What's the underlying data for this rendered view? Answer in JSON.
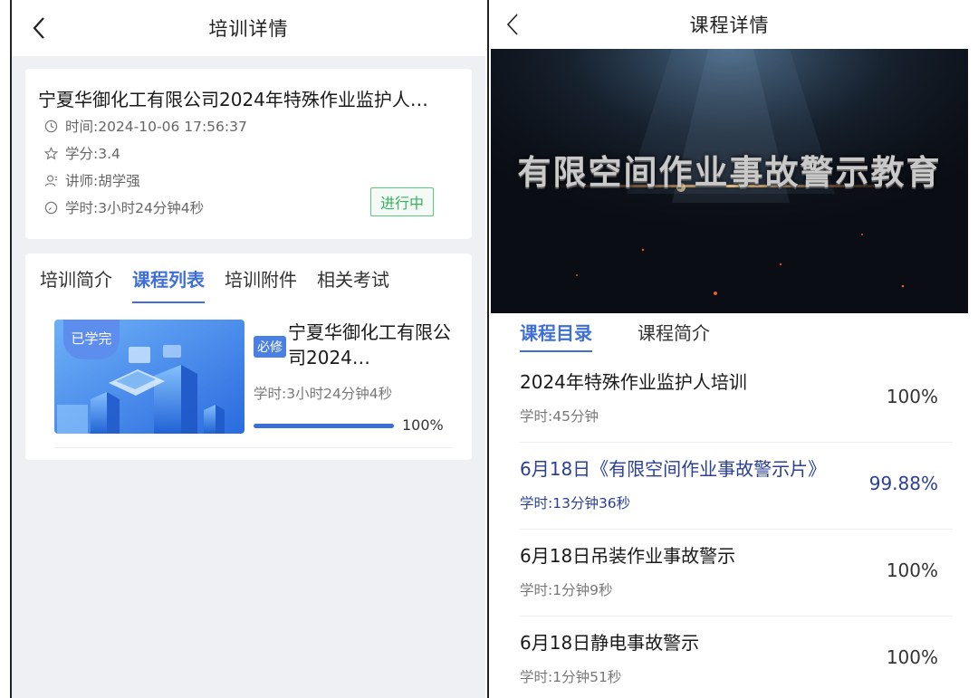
{
  "left": {
    "header": {
      "title": "培训详情"
    },
    "info": {
      "title": "宁夏华御化工有限公司2024年特殊作业监护人…",
      "time": "时间:2024-10-06 17:56:37",
      "credit": "学分:3.4",
      "lecturer": "讲师:胡学强",
      "hours": "学时:3小时24分钟4秒",
      "status": "进行中"
    },
    "tabs": [
      {
        "label": "培训简介"
      },
      {
        "label": "课程列表"
      },
      {
        "label": "培训附件"
      },
      {
        "label": "相关考试"
      }
    ],
    "course": {
      "badge": "已学完",
      "required": "必修",
      "name": "宁夏华御化工有限公司2024…",
      "hours": "学时:3小时24分钟4秒",
      "progress_percent": 100,
      "progress_text": "100%"
    }
  },
  "right": {
    "header": {
      "title": "课程详情"
    },
    "video": {
      "caption": "有限空间作业事故警示教育"
    },
    "tabs": [
      {
        "label": "课程目录"
      },
      {
        "label": "课程简介"
      }
    ],
    "lessons": [
      {
        "title": "2024年特殊作业监护人培训",
        "hours": "学时:45分钟",
        "percent": "100%"
      },
      {
        "title": "6月18日《有限空间作业事故警示片》",
        "hours": "学时:13分钟36秒",
        "percent": "99.88%"
      },
      {
        "title": "6月18日吊装作业事故警示",
        "hours": "学时:1分钟9秒",
        "percent": "100%"
      },
      {
        "title": "6月18日静电事故警示",
        "hours": "学时:1分钟51秒",
        "percent": "100%"
      }
    ]
  },
  "colors": {
    "accent": "#3f6fd6",
    "status_green": "#36b25e",
    "current_lesson": "#2a3f95",
    "page_bg": "#eff0f4"
  }
}
